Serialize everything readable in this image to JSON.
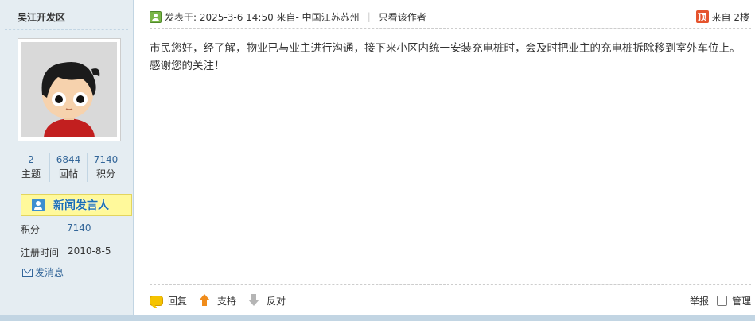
{
  "author": {
    "name": "吴江开发区",
    "stats": [
      {
        "value": "2",
        "label": "主题"
      },
      {
        "value": "6844",
        "label": "回帖"
      },
      {
        "value": "7140",
        "label": "积分"
      }
    ],
    "badge": "新闻发言人",
    "points_label": "积分",
    "points_value": "7140",
    "register_label": "注册时间",
    "register_value": "2010-8-5",
    "pm_label": "发消息"
  },
  "post": {
    "posted_prefix": "发表于: 2025-3-6 14:50 来自- 中国江苏苏州",
    "separator": "|",
    "only_author": "只看该作者",
    "top_icon": "顶",
    "floor": "来自 2楼",
    "content": "市民您好，经了解，物业已与业主进行沟通，接下来小区内统一安装充电桩时，会及时把业主的充电桩拆除移到室外车位上。感谢您的关注！"
  },
  "actions": {
    "reply": "回复",
    "support": "支持",
    "oppose": "反对",
    "report": "举报",
    "manage": "管理"
  },
  "colors": {
    "sidebar_bg": "#e5edf2",
    "link": "#336699",
    "badge_bg": "#fff99b"
  }
}
